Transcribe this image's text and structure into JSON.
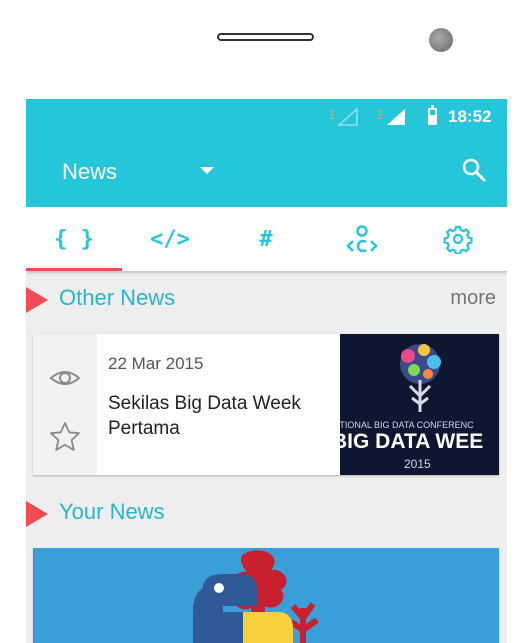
{
  "status_bar": {
    "sim1_label": "1",
    "sim2_label": "2",
    "time": "18:52"
  },
  "app_bar": {
    "title": "News"
  },
  "tabs": [
    {
      "label": "{ }",
      "icon": "braces-icon"
    },
    {
      "label": "</>",
      "icon": "code-icon"
    },
    {
      "label": "#",
      "icon": "hash-icon"
    },
    {
      "label": "",
      "icon": "community-icon"
    },
    {
      "label": "",
      "icon": "gear-icon"
    }
  ],
  "other_news": {
    "title": "Other News",
    "more_label": "more",
    "items": [
      {
        "date": "22 Mar 2015",
        "title": "Sekilas Big Data Week Pertama",
        "thumbnail": {
          "line1": "ATIONAL BIG DATA CONFERENC",
          "line2": "BIG DATA WEE",
          "line3": "2015"
        }
      }
    ]
  },
  "your_news": {
    "title": "Your News"
  },
  "colors": {
    "primary": "#26c6da",
    "accent": "#f24b55",
    "background": "#eeeeee"
  }
}
